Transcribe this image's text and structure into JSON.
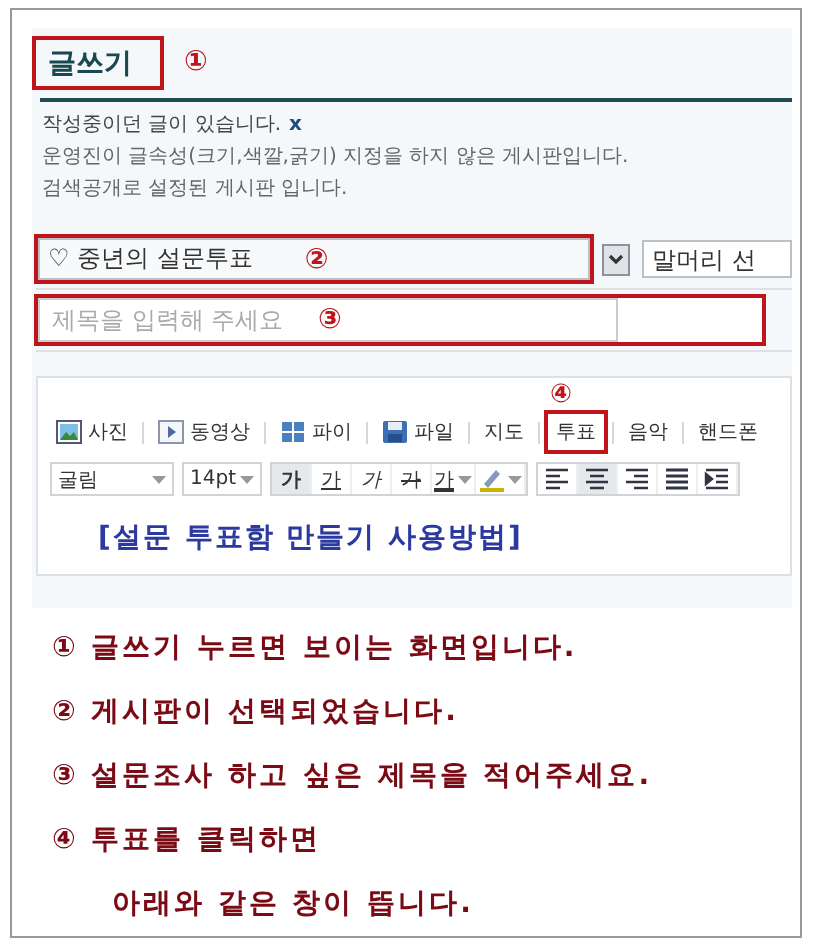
{
  "header": {
    "title": "글쓰기",
    "marker": "①"
  },
  "notices": [
    {
      "text": "작성중이던 글이 있습니다.",
      "dismiss": "x"
    },
    {
      "text": "운영진이 글속성(크기,색깔,굵기) 지정을 하지 않은 게시판입니다."
    },
    {
      "text": "검색공개로 설정된 게시판 입니다."
    }
  ],
  "board_select": {
    "value": "♡ 중년의 설문투표",
    "marker": "②"
  },
  "prefix_select": {
    "value": "말머리 선"
  },
  "title_field": {
    "placeholder": "제목을 입력해 주세요",
    "marker": "③"
  },
  "attach_toolbar": {
    "marker": "④",
    "items": [
      {
        "kind": "photo",
        "label": "사진",
        "selected": false
      },
      {
        "kind": "video",
        "label": "동영상",
        "selected": false
      },
      {
        "kind": "grid",
        "label": "파이",
        "selected": false
      },
      {
        "kind": "file",
        "label": "파일",
        "selected": false
      },
      {
        "kind": "text",
        "label": "지도",
        "selected": false
      },
      {
        "kind": "text",
        "label": "투표",
        "selected": true
      },
      {
        "kind": "text",
        "label": "음악",
        "selected": false
      },
      {
        "kind": "text",
        "label": "핸드폰",
        "selected": false
      }
    ]
  },
  "format_toolbar": {
    "font": "굴림",
    "size": "14pt",
    "buttons": [
      {
        "kind": "bold",
        "label": "가",
        "pressed": true
      },
      {
        "kind": "underline",
        "label": "가",
        "pressed": false
      },
      {
        "kind": "italic",
        "label": "가",
        "pressed": false
      },
      {
        "kind": "strike",
        "label": "가",
        "pressed": false
      },
      {
        "kind": "color",
        "label": "가",
        "pressed": false
      },
      {
        "kind": "highlight",
        "pressed": false
      },
      {
        "kind": "align-left",
        "pressed": false
      },
      {
        "kind": "align-center",
        "pressed": true
      },
      {
        "kind": "align-right",
        "pressed": false
      },
      {
        "kind": "justify",
        "pressed": false
      },
      {
        "kind": "indent",
        "pressed": false
      }
    ]
  },
  "editor_heading": "[설문 투표함 만들기 사용방법]",
  "instructions": [
    "① 글쓰기 누르면 보이는 화면입니다.",
    "② 게시판이 선택되었습니다.",
    "③ 설문조사 하고 싶은 제목을 적어주세요.",
    "④ 투표를 클릭하면",
    "아래와 같은 창이 뜹니다."
  ]
}
